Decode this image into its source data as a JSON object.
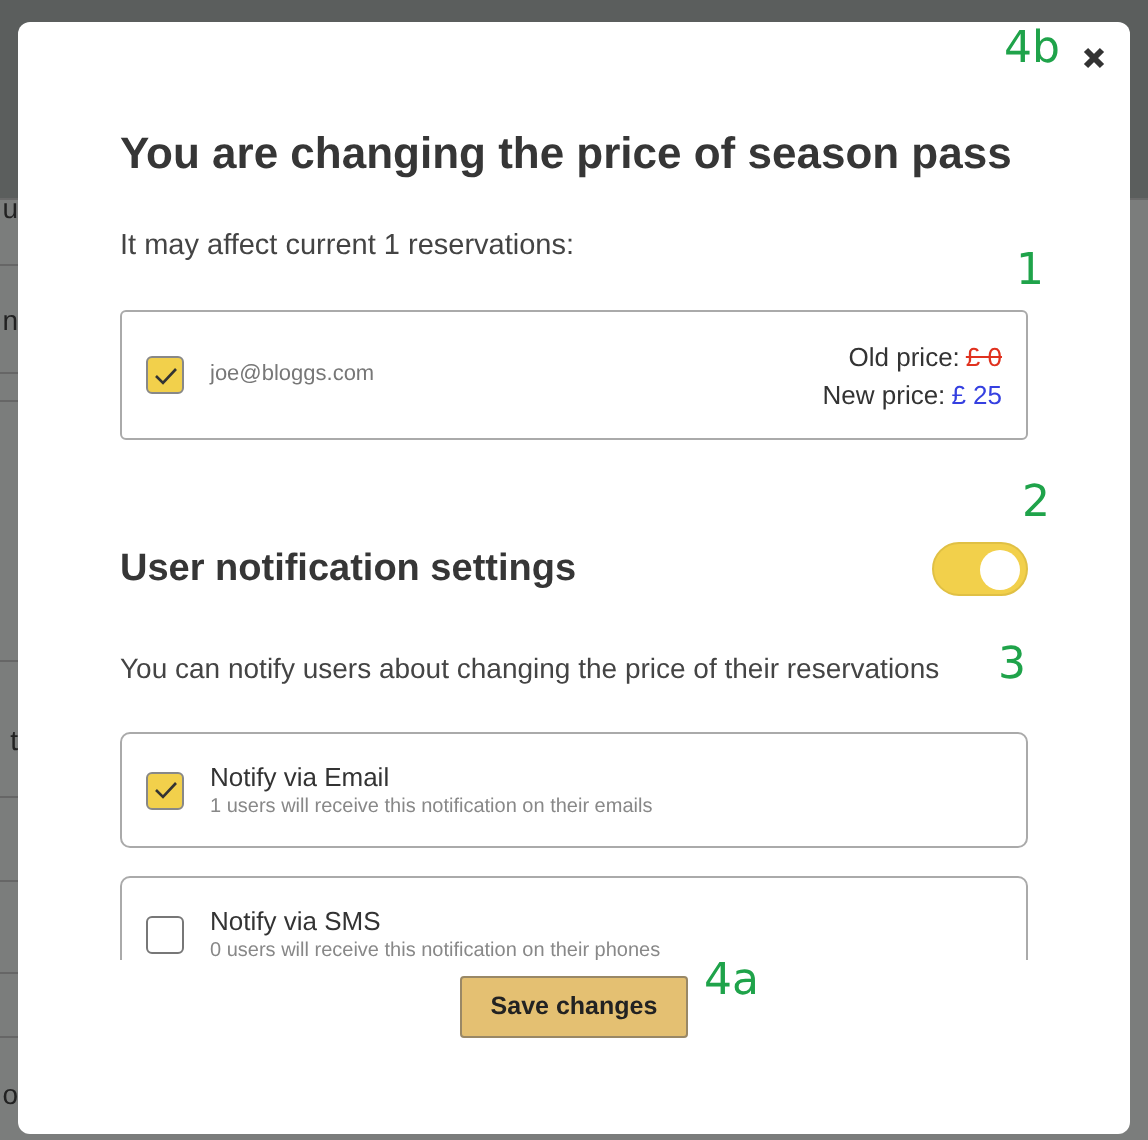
{
  "background_texts": [
    "u",
    "n",
    "t",
    "o"
  ],
  "dialog": {
    "title": "You are changing the price of season pass",
    "subtitle": "It may affect current 1 reservations:",
    "reservations": [
      {
        "email": "joe@bloggs.com",
        "checked": true,
        "old_label": "Old price:",
        "old_price": "£ 0",
        "new_label": "New price:",
        "new_price": "£ 25"
      }
    ],
    "notification_heading": "User notification settings",
    "notifications_on": true,
    "notification_text": "You can notify users about changing the price of their reservations",
    "options": [
      {
        "label": "Notify via Email",
        "hint": "1 users will receive this notification on their emails",
        "checked": true
      },
      {
        "label": "Notify via SMS",
        "hint": "0 users will receive this notification on their phones",
        "checked": false
      }
    ],
    "save_button": "Save changes"
  },
  "annotations": [
    "4b",
    "1",
    "2",
    "3",
    "4a"
  ]
}
